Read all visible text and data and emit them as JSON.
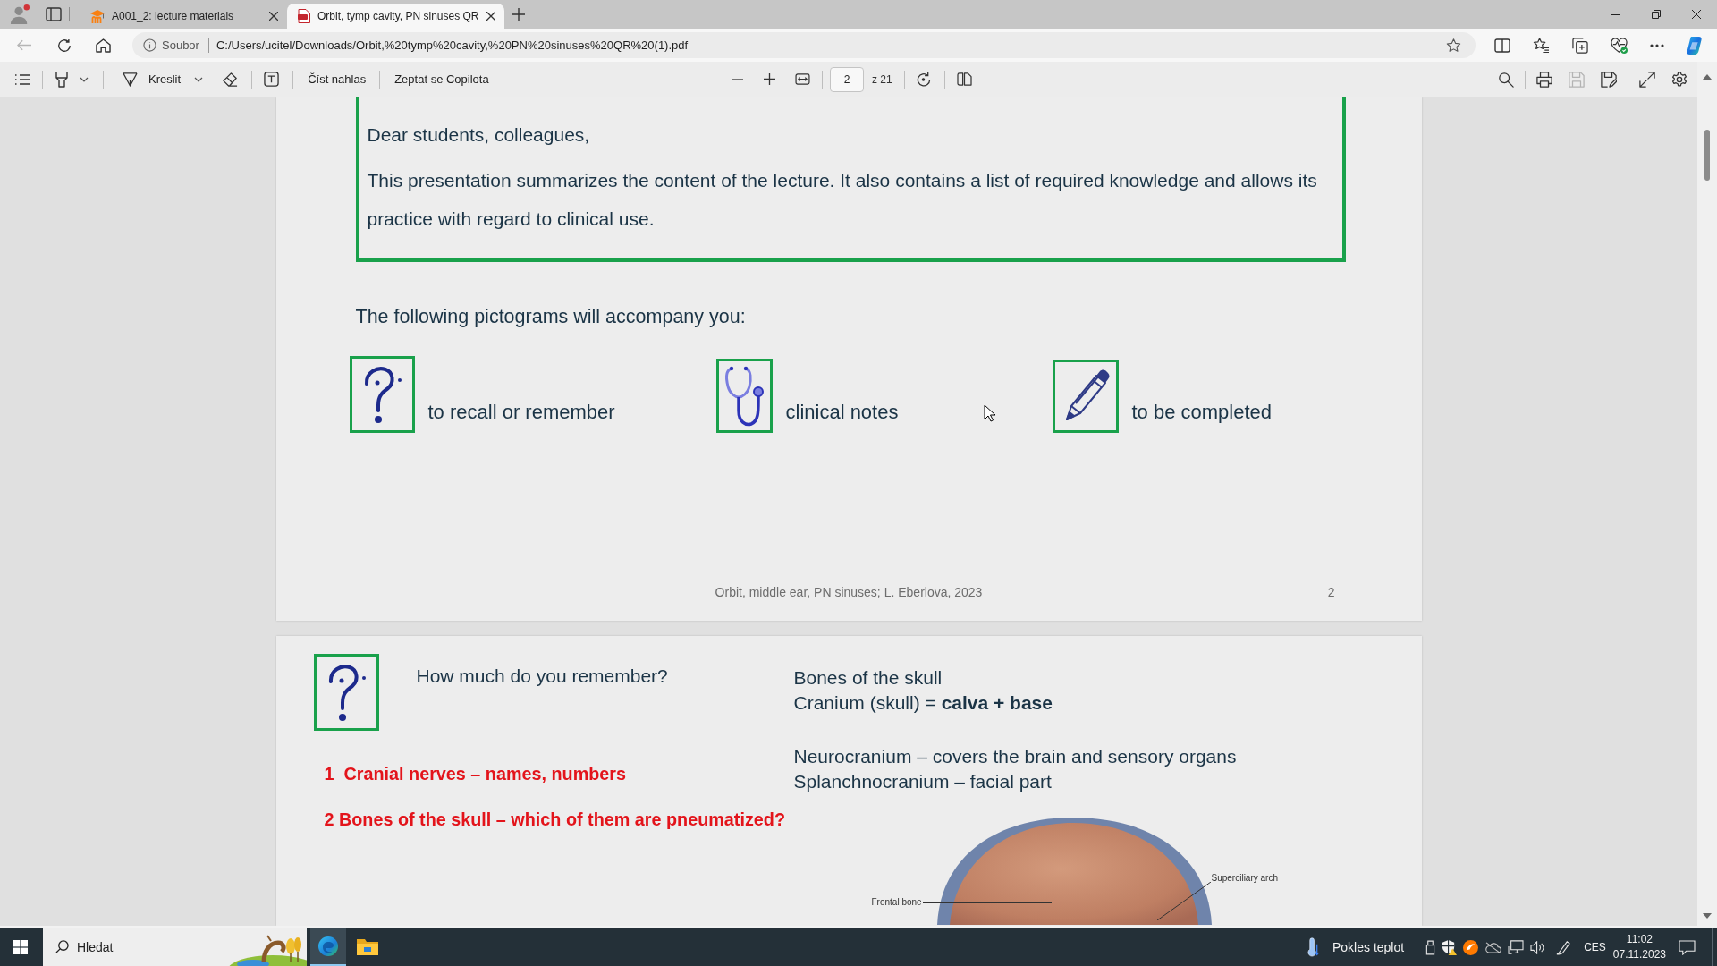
{
  "browser": {
    "tabs": [
      {
        "kind": "course-site",
        "title": "A001_2: lecture materials",
        "selected": false
      },
      {
        "kind": "pdf",
        "title": "Orbit, tymp cavity, PN sinuses QR",
        "selected": true
      }
    ],
    "back_button": {
      "disabled": true
    },
    "address_bar": {
      "site_info": "Soubor",
      "url": "C:/Users/ucitel/Downloads/Orbit,%20tymp%20cavity,%20PN%20sinuses%20QR%20(1).pdf"
    }
  },
  "pdf_toolbar": {
    "draw_label": "Kreslit",
    "read_aloud_label": "Číst nahlas",
    "copilot_label": "Zeptat se Copilota",
    "page_field": {
      "value": "2"
    },
    "page_count": "z 21",
    "tools": [
      {
        "kind": "search",
        "disabled": false
      },
      {
        "kind": "print",
        "disabled": false
      },
      {
        "kind": "save",
        "disabled": true
      },
      {
        "kind": "save-as",
        "disabled": false
      },
      {
        "kind": "fullscreen",
        "disabled": false
      },
      {
        "kind": "settings",
        "disabled": false
      }
    ]
  },
  "document": {
    "intro_page": {
      "greeting": "Dear students, colleagues,",
      "message": "This presentation summarizes the content of the lecture. It also contains a list of required knowledge and allows its practice with regard to clinical use.",
      "pictograms_heading": "The following pictograms will accompany you:",
      "pictograms": [
        {
          "kind": "question",
          "label": "to recall or remember"
        },
        {
          "kind": "stethoscope",
          "label": "clinical notes"
        },
        {
          "kind": "pencil",
          "label": "to be completed"
        }
      ],
      "footer": "Orbit, middle ear, PN sinuses; L. Eberlova, 2023",
      "page_number": "2"
    },
    "quiz_page": {
      "pictogram": {
        "kind": "question"
      },
      "heading": "How much do you remember?",
      "questions": [
        "1  Cranial nerves – names, numbers",
        "2 Bones of the skull – which of them are pneumatized?"
      ],
      "note_groups": [
        {
          "lines": [
            "Bones of the skull",
            "Cranium (skull) = **calva + base**"
          ]
        },
        {
          "lines": [
            "Neurocranium – covers the brain and sensory organs",
            "Splanchnocranium – facial part"
          ]
        }
      ],
      "figure_labels": [
        "Frontal bone",
        "Superciliary arch"
      ]
    }
  },
  "taskbar": {
    "search": {
      "placeholder": "Hledat"
    },
    "apps": [
      {
        "kind": "edge",
        "active": true
      },
      {
        "kind": "explorer",
        "active": false
      }
    ],
    "weather": "Pokles teplot",
    "language": "CES",
    "time": "11:02",
    "date": "07.11.2023"
  }
}
